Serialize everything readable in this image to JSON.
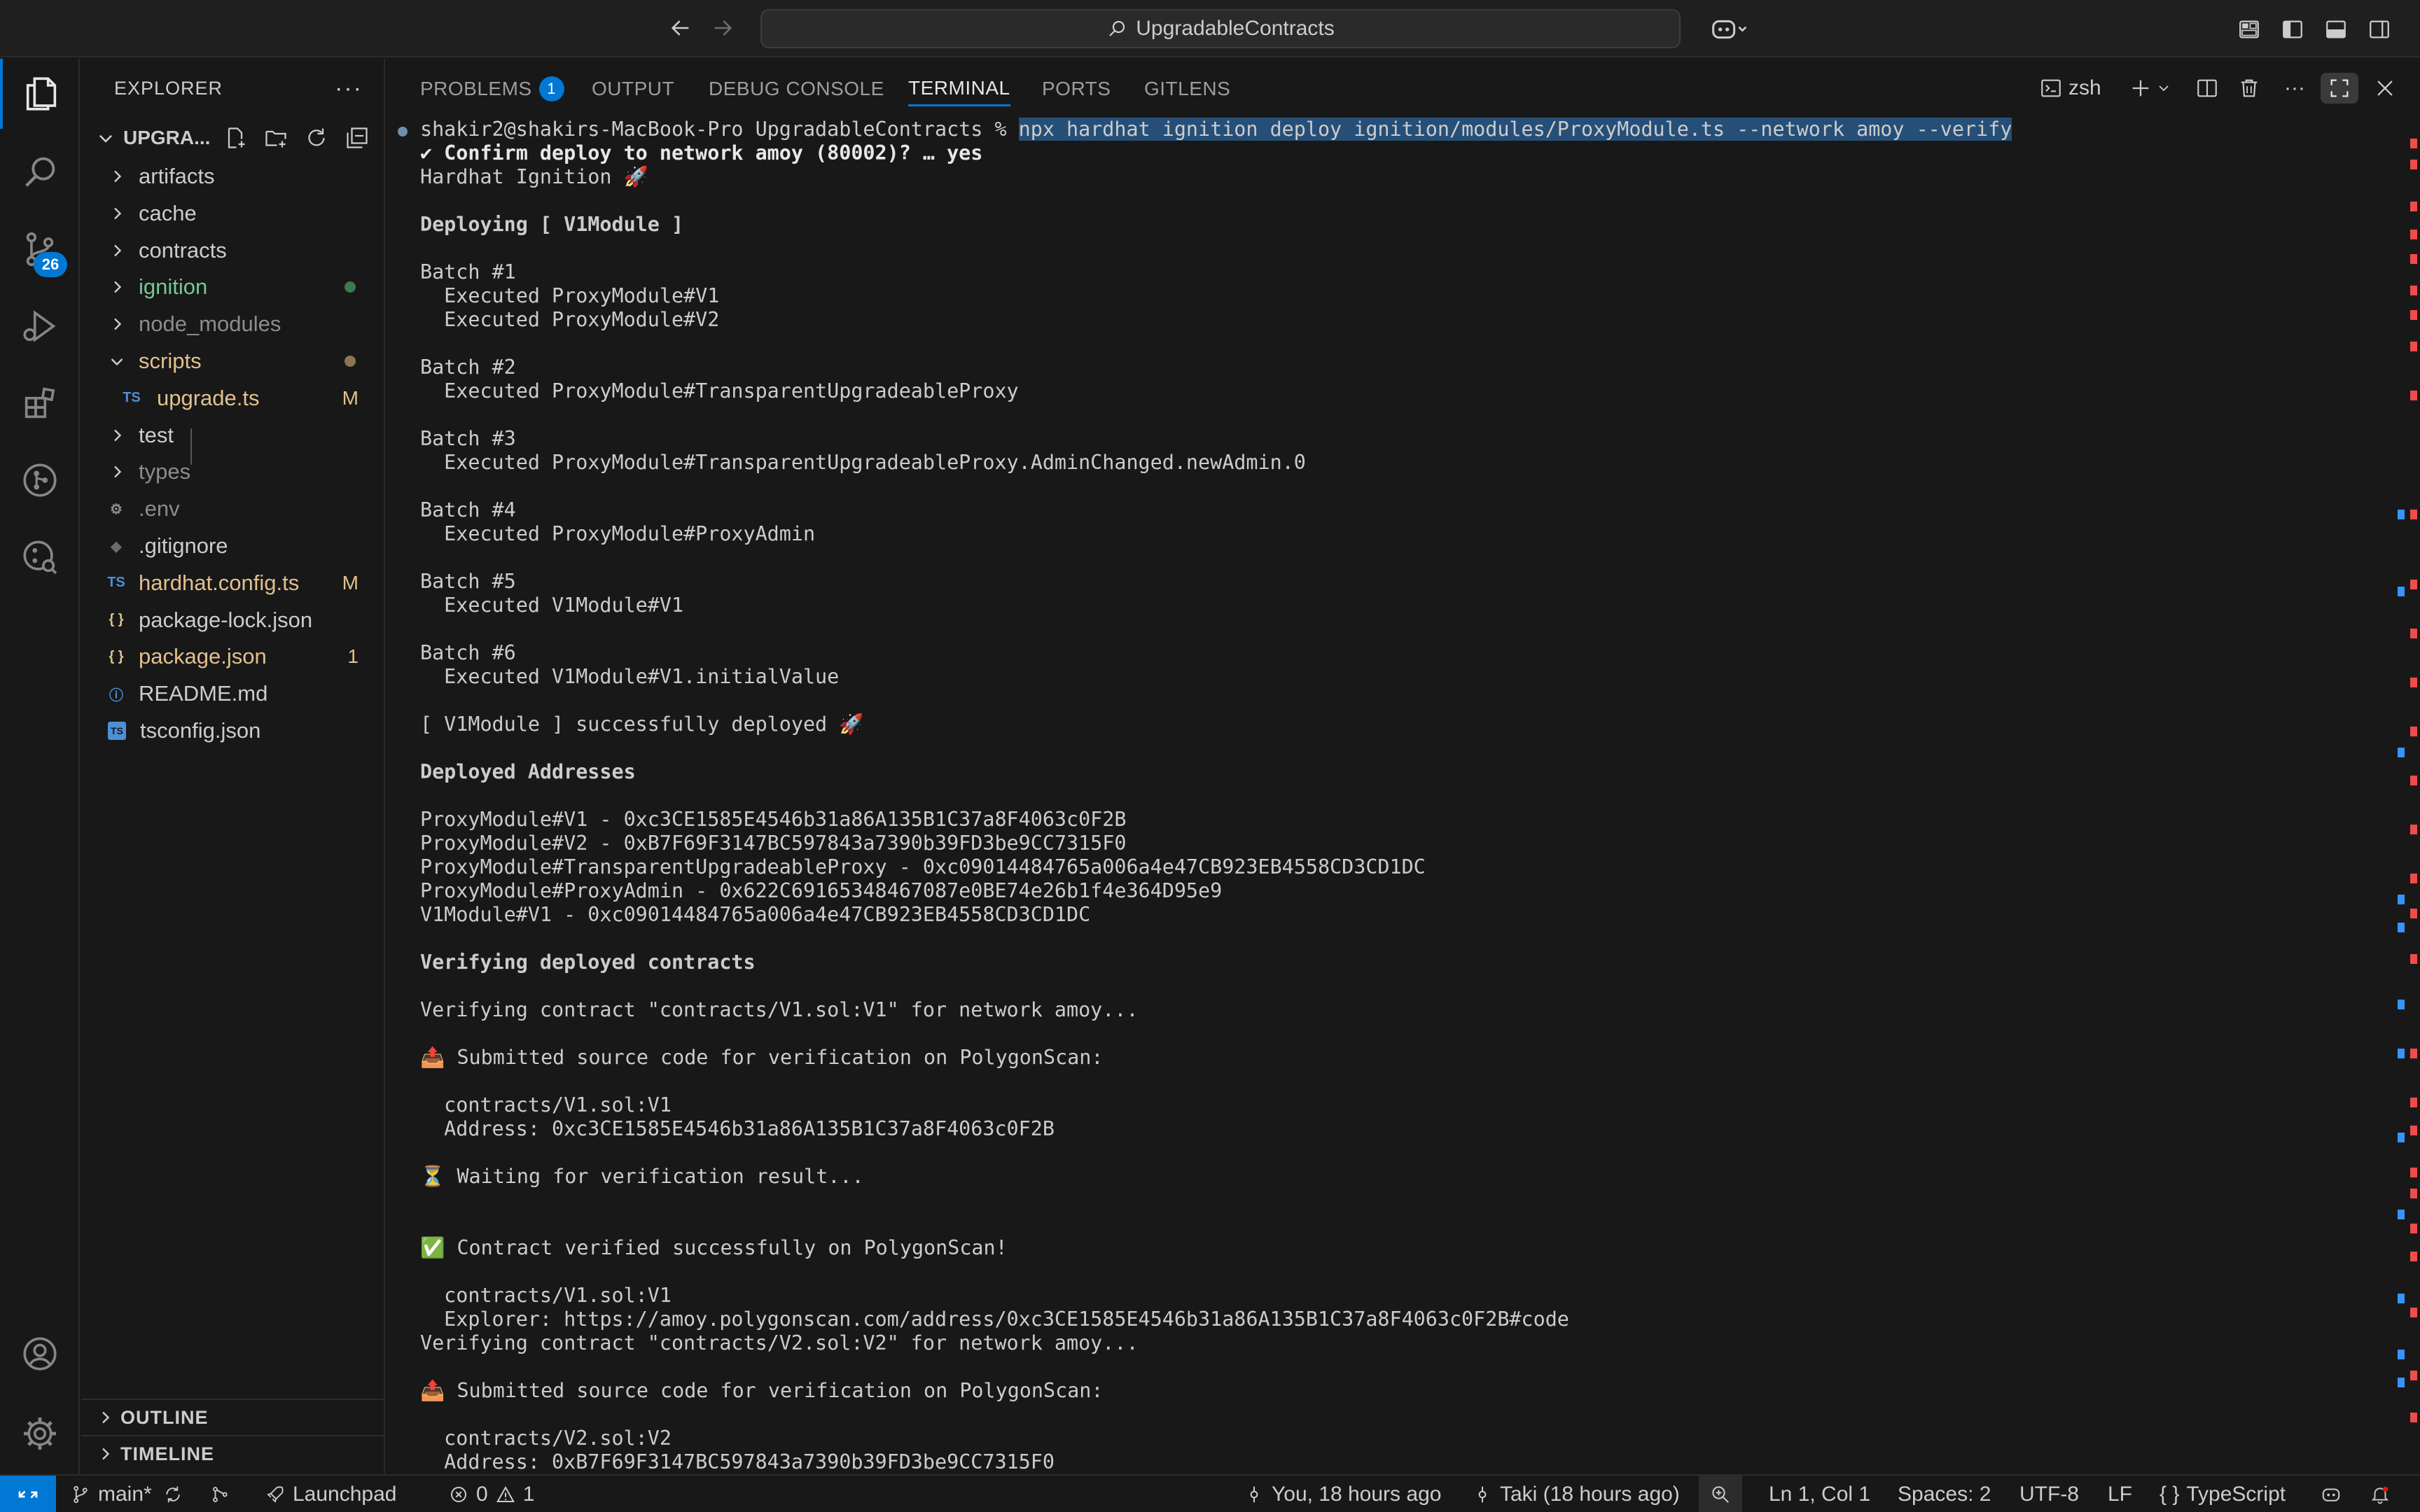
{
  "titlebar": {
    "search_text": "UpgradableContracts",
    "back_label": "←",
    "forward_label": "→"
  },
  "activity": {
    "source_control_badge": "26"
  },
  "sidebar": {
    "title": "EXPLORER",
    "more": "···",
    "project": "UPGRA...",
    "items": [
      {
        "label": "artifacts",
        "kind": "folder",
        "expanded": false,
        "color": "#cccccc"
      },
      {
        "label": "cache",
        "kind": "folder",
        "expanded": false,
        "color": "#cccccc"
      },
      {
        "label": "contracts",
        "kind": "folder",
        "expanded": false,
        "color": "#cccccc"
      },
      {
        "label": "ignition",
        "kind": "folder",
        "expanded": false,
        "color": "#73c991",
        "decoration": "dot-green"
      },
      {
        "label": "node_modules",
        "kind": "folder",
        "expanded": false,
        "color": "#8c8c8c"
      },
      {
        "label": "scripts",
        "kind": "folder",
        "expanded": true,
        "color": "#e2c08d",
        "decoration": "dot-yellow"
      },
      {
        "label": "upgrade.ts",
        "kind": "ts",
        "color": "#e2c08d",
        "decoration": "M"
      },
      {
        "label": "test",
        "kind": "folder",
        "expanded": false,
        "color": "#cccccc"
      },
      {
        "label": "types",
        "kind": "folder",
        "expanded": false,
        "color": "#8c8c8c"
      },
      {
        "label": ".env",
        "kind": "env",
        "color": "#8c8c8c"
      },
      {
        "label": ".gitignore",
        "kind": "git",
        "color": "#cccccc"
      },
      {
        "label": "hardhat.config.ts",
        "kind": "ts",
        "color": "#e2c08d",
        "decoration": "M"
      },
      {
        "label": "package-lock.json",
        "kind": "json",
        "color": "#cccccc"
      },
      {
        "label": "package.json",
        "kind": "json",
        "color": "#e2c08d",
        "decoration": "1"
      },
      {
        "label": "README.md",
        "kind": "info",
        "color": "#cccccc"
      },
      {
        "label": "tsconfig.json",
        "kind": "tsconfig",
        "color": "#cccccc"
      }
    ],
    "outline": "OUTLINE",
    "timeline": "TIMELINE"
  },
  "panel": {
    "tabs": [
      "PROBLEMS",
      "OUTPUT",
      "DEBUG CONSOLE",
      "TERMINAL",
      "PORTS",
      "GITLENS"
    ],
    "problems_badge": "1",
    "active_tab": "TERMINAL",
    "shell": "zsh"
  },
  "terminal": {
    "prompt": "shakir2@shakirs-MacBook-Pro UpgradableContracts % ",
    "command": "npx hardhat ignition deploy ignition/modules/ProxyModule.ts --network amoy --verify",
    "lines": [
      {
        "text": "✔ Confirm deploy to network amoy (80002)? … yes",
        "style": "confirm"
      },
      {
        "text": "Hardhat Ignition 🚀"
      },
      {
        "text": ""
      },
      {
        "text": "Deploying [ V1Module ]",
        "style": "bold"
      },
      {
        "text": ""
      },
      {
        "text": "Batch #1"
      },
      {
        "text": "  Executed ProxyModule#V1"
      },
      {
        "text": "  Executed ProxyModule#V2"
      },
      {
        "text": ""
      },
      {
        "text": "Batch #2"
      },
      {
        "text": "  Executed ProxyModule#TransparentUpgradeableProxy"
      },
      {
        "text": ""
      },
      {
        "text": "Batch #3"
      },
      {
        "text": "  Executed ProxyModule#TransparentUpgradeableProxy.AdminChanged.newAdmin.0"
      },
      {
        "text": ""
      },
      {
        "text": "Batch #4"
      },
      {
        "text": "  Executed ProxyModule#ProxyAdmin"
      },
      {
        "text": ""
      },
      {
        "text": "Batch #5"
      },
      {
        "text": "  Executed V1Module#V1"
      },
      {
        "text": ""
      },
      {
        "text": "Batch #6"
      },
      {
        "text": "  Executed V1Module#V1.initialValue"
      },
      {
        "text": ""
      },
      {
        "text": "[ V1Module ] successfully deployed 🚀"
      },
      {
        "text": ""
      },
      {
        "text": "Deployed Addresses",
        "style": "bold"
      },
      {
        "text": ""
      },
      {
        "text": "ProxyModule#V1 - 0xc3CE1585E4546b31a86A135B1C37a8F4063c0F2B"
      },
      {
        "text": "ProxyModule#V2 - 0xB7F69F3147BC597843a7390b39FD3be9CC7315F0"
      },
      {
        "text": "ProxyModule#TransparentUpgradeableProxy - 0xc09014484765a006a4e47CB923EB4558CD3CD1DC"
      },
      {
        "text": "ProxyModule#ProxyAdmin - 0x622C69165348467087e0BE74e26b1f4e364D95e9"
      },
      {
        "text": "V1Module#V1 - 0xc09014484765a006a4e47CB923EB4558CD3CD1DC"
      },
      {
        "text": ""
      },
      {
        "text": "Verifying deployed contracts",
        "style": "bold"
      },
      {
        "text": ""
      },
      {
        "text": "Verifying contract \"contracts/V1.sol:V1\" for network amoy..."
      },
      {
        "text": ""
      },
      {
        "text": "📤 Submitted source code for verification on PolygonScan:"
      },
      {
        "text": ""
      },
      {
        "text": "  contracts/V1.sol:V1"
      },
      {
        "text": "  Address: 0xc3CE1585E4546b31a86A135B1C37a8F4063c0F2B"
      },
      {
        "text": ""
      },
      {
        "text": "⏳ Waiting for verification result..."
      },
      {
        "text": ""
      },
      {
        "text": ""
      },
      {
        "text": "✅ Contract verified successfully on PolygonScan!"
      },
      {
        "text": ""
      },
      {
        "text": "  contracts/V1.sol:V1"
      },
      {
        "text": "  Explorer: https://amoy.polygonscan.com/address/0xc3CE1585E4546b31a86A135B1C37a8F4063c0F2B#code"
      },
      {
        "text": "Verifying contract \"contracts/V2.sol:V2\" for network amoy..."
      },
      {
        "text": ""
      },
      {
        "text": "📤 Submitted source code for verification on PolygonScan:"
      },
      {
        "text": ""
      },
      {
        "text": "  contracts/V2.sol:V2"
      },
      {
        "text": "  Address: 0xB7F69F3147BC597843a7390b39FD3be9CC7315F0"
      }
    ]
  },
  "statusbar": {
    "branch": "main*",
    "launchpad": "Launchpad",
    "errors": "0",
    "warnings": "1",
    "blame": "You, 18 hours ago",
    "author": "Taki (18 hours ago)",
    "cursor": "Ln 1, Col 1",
    "spaces": "Spaces: 2",
    "encoding": "UTF-8",
    "eol": "LF",
    "language": "TypeScript"
  },
  "colors": {
    "accent": "#0078d4",
    "modified": "#e2c08d",
    "untracked": "#73c991",
    "selection": "#264f78"
  }
}
